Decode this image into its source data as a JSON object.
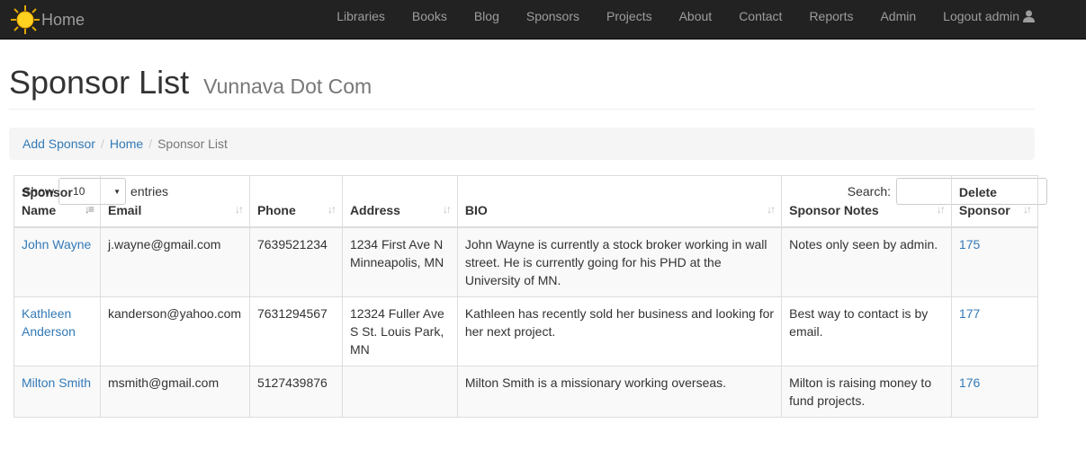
{
  "nav": {
    "brand": "Home",
    "items": [
      "Libraries",
      "Books",
      "Blog",
      "Sponsors",
      "Projects",
      "About",
      "Contact",
      "Reports",
      "Admin",
      "Logout admin"
    ]
  },
  "header": {
    "title": "Sponsor List",
    "subtitle": "Vunnava Dot Com"
  },
  "breadcrumb": {
    "add": "Add Sponsor",
    "home": "Home",
    "current": "Sponsor List",
    "separator": "/"
  },
  "controls": {
    "show_label": "Show",
    "entries_value": "10",
    "entries_label": "entries",
    "search_label": "Search:"
  },
  "table": {
    "headers": [
      {
        "line1": "Sponsor",
        "line2": "Name"
      },
      {
        "line1": "",
        "line2": "Email"
      },
      {
        "line1": "",
        "line2": "Phone"
      },
      {
        "line1": "",
        "line2": "Address"
      },
      {
        "line1": "",
        "line2": "BIO"
      },
      {
        "line1": "",
        "line2": "Sponsor Notes"
      },
      {
        "line1": "Delete",
        "line2": "Sponsor"
      }
    ],
    "rows": [
      {
        "name": "John Wayne",
        "email": "j.wayne@gmail.com",
        "phone": "7639521234",
        "address": "1234 First Ave N Minneapolis, MN",
        "bio": "John Wayne is currently a stock broker working in wall street. He is currently going for his PHD at the University of MN.",
        "notes": "Notes only seen by admin.",
        "delete": "175"
      },
      {
        "name": "Kathleen Anderson",
        "email": "kanderson@yahoo.com",
        "phone": "7631294567",
        "address": "12324 Fuller Ave S St. Louis Park, MN",
        "bio": "Kathleen has recently sold her business and looking for her next project.",
        "notes": "Best way to contact is by email.",
        "delete": "177"
      },
      {
        "name": "Milton Smith",
        "email": "msmith@gmail.com",
        "phone": "5127439876",
        "address": "",
        "bio": "Milton Smith is a missionary working overseas.",
        "notes": "Milton is raising money to fund projects.",
        "delete": "176"
      }
    ]
  },
  "colors": {
    "navbar": "#222222",
    "link": "#337ab7",
    "nav_text": "#9d9d9d"
  }
}
